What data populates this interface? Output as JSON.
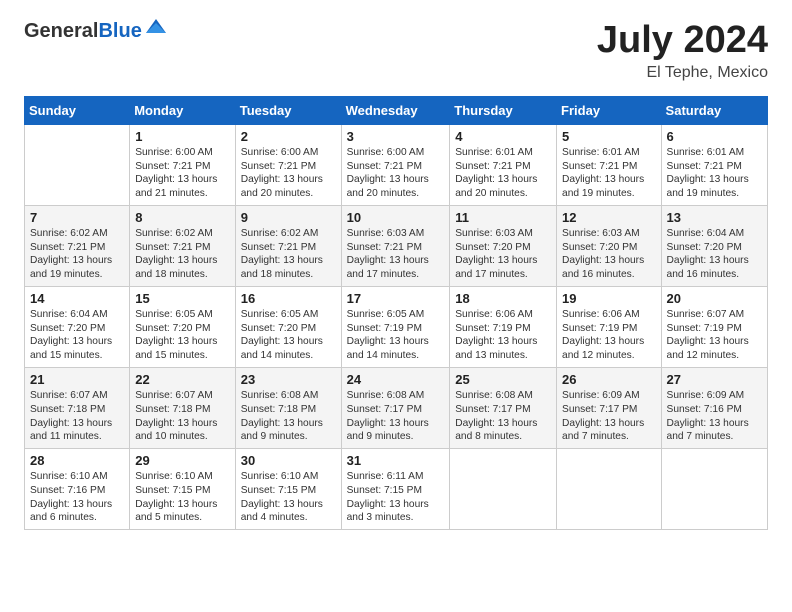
{
  "header": {
    "logo_general": "General",
    "logo_blue": "Blue",
    "month": "July 2024",
    "location": "El Tephe, Mexico"
  },
  "days_of_week": [
    "Sunday",
    "Monday",
    "Tuesday",
    "Wednesday",
    "Thursday",
    "Friday",
    "Saturday"
  ],
  "weeks": [
    [
      {
        "day": "",
        "info": ""
      },
      {
        "day": "1",
        "info": "Sunrise: 6:00 AM\nSunset: 7:21 PM\nDaylight: 13 hours\nand 21 minutes."
      },
      {
        "day": "2",
        "info": "Sunrise: 6:00 AM\nSunset: 7:21 PM\nDaylight: 13 hours\nand 20 minutes."
      },
      {
        "day": "3",
        "info": "Sunrise: 6:00 AM\nSunset: 7:21 PM\nDaylight: 13 hours\nand 20 minutes."
      },
      {
        "day": "4",
        "info": "Sunrise: 6:01 AM\nSunset: 7:21 PM\nDaylight: 13 hours\nand 20 minutes."
      },
      {
        "day": "5",
        "info": "Sunrise: 6:01 AM\nSunset: 7:21 PM\nDaylight: 13 hours\nand 19 minutes."
      },
      {
        "day": "6",
        "info": "Sunrise: 6:01 AM\nSunset: 7:21 PM\nDaylight: 13 hours\nand 19 minutes."
      }
    ],
    [
      {
        "day": "7",
        "info": "Sunrise: 6:02 AM\nSunset: 7:21 PM\nDaylight: 13 hours\nand 19 minutes."
      },
      {
        "day": "8",
        "info": "Sunrise: 6:02 AM\nSunset: 7:21 PM\nDaylight: 13 hours\nand 18 minutes."
      },
      {
        "day": "9",
        "info": "Sunrise: 6:02 AM\nSunset: 7:21 PM\nDaylight: 13 hours\nand 18 minutes."
      },
      {
        "day": "10",
        "info": "Sunrise: 6:03 AM\nSunset: 7:21 PM\nDaylight: 13 hours\nand 17 minutes."
      },
      {
        "day": "11",
        "info": "Sunrise: 6:03 AM\nSunset: 7:20 PM\nDaylight: 13 hours\nand 17 minutes."
      },
      {
        "day": "12",
        "info": "Sunrise: 6:03 AM\nSunset: 7:20 PM\nDaylight: 13 hours\nand 16 minutes."
      },
      {
        "day": "13",
        "info": "Sunrise: 6:04 AM\nSunset: 7:20 PM\nDaylight: 13 hours\nand 16 minutes."
      }
    ],
    [
      {
        "day": "14",
        "info": "Sunrise: 6:04 AM\nSunset: 7:20 PM\nDaylight: 13 hours\nand 15 minutes."
      },
      {
        "day": "15",
        "info": "Sunrise: 6:05 AM\nSunset: 7:20 PM\nDaylight: 13 hours\nand 15 minutes."
      },
      {
        "day": "16",
        "info": "Sunrise: 6:05 AM\nSunset: 7:20 PM\nDaylight: 13 hours\nand 14 minutes."
      },
      {
        "day": "17",
        "info": "Sunrise: 6:05 AM\nSunset: 7:19 PM\nDaylight: 13 hours\nand 14 minutes."
      },
      {
        "day": "18",
        "info": "Sunrise: 6:06 AM\nSunset: 7:19 PM\nDaylight: 13 hours\nand 13 minutes."
      },
      {
        "day": "19",
        "info": "Sunrise: 6:06 AM\nSunset: 7:19 PM\nDaylight: 13 hours\nand 12 minutes."
      },
      {
        "day": "20",
        "info": "Sunrise: 6:07 AM\nSunset: 7:19 PM\nDaylight: 13 hours\nand 12 minutes."
      }
    ],
    [
      {
        "day": "21",
        "info": "Sunrise: 6:07 AM\nSunset: 7:18 PM\nDaylight: 13 hours\nand 11 minutes."
      },
      {
        "day": "22",
        "info": "Sunrise: 6:07 AM\nSunset: 7:18 PM\nDaylight: 13 hours\nand 10 minutes."
      },
      {
        "day": "23",
        "info": "Sunrise: 6:08 AM\nSunset: 7:18 PM\nDaylight: 13 hours\nand 9 minutes."
      },
      {
        "day": "24",
        "info": "Sunrise: 6:08 AM\nSunset: 7:17 PM\nDaylight: 13 hours\nand 9 minutes."
      },
      {
        "day": "25",
        "info": "Sunrise: 6:08 AM\nSunset: 7:17 PM\nDaylight: 13 hours\nand 8 minutes."
      },
      {
        "day": "26",
        "info": "Sunrise: 6:09 AM\nSunset: 7:17 PM\nDaylight: 13 hours\nand 7 minutes."
      },
      {
        "day": "27",
        "info": "Sunrise: 6:09 AM\nSunset: 7:16 PM\nDaylight: 13 hours\nand 7 minutes."
      }
    ],
    [
      {
        "day": "28",
        "info": "Sunrise: 6:10 AM\nSunset: 7:16 PM\nDaylight: 13 hours\nand 6 minutes."
      },
      {
        "day": "29",
        "info": "Sunrise: 6:10 AM\nSunset: 7:15 PM\nDaylight: 13 hours\nand 5 minutes."
      },
      {
        "day": "30",
        "info": "Sunrise: 6:10 AM\nSunset: 7:15 PM\nDaylight: 13 hours\nand 4 minutes."
      },
      {
        "day": "31",
        "info": "Sunrise: 6:11 AM\nSunset: 7:15 PM\nDaylight: 13 hours\nand 3 minutes."
      },
      {
        "day": "",
        "info": ""
      },
      {
        "day": "",
        "info": ""
      },
      {
        "day": "",
        "info": ""
      }
    ]
  ]
}
